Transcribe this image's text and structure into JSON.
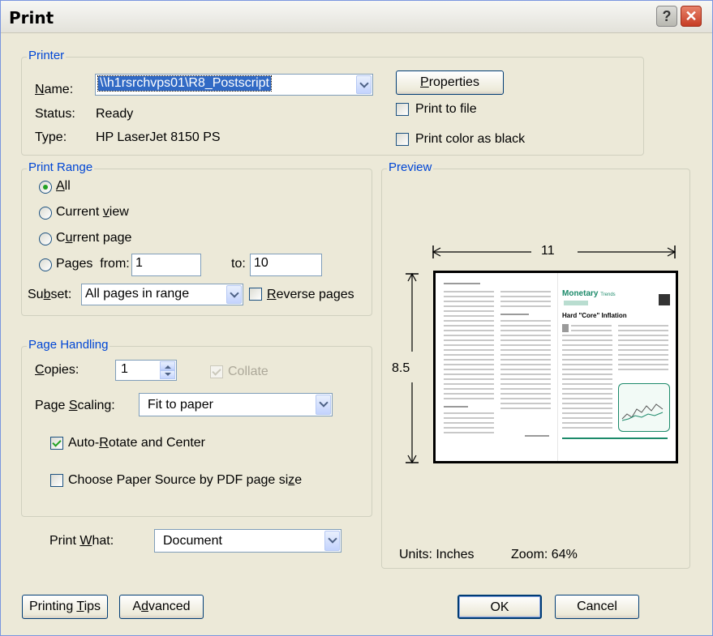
{
  "window": {
    "title": "Print"
  },
  "printer": {
    "legend": "Printer",
    "name_label": "Name:",
    "name_value": "\\\\h1rsrchvps01\\R8_Postscript",
    "status_label": "Status:",
    "status_value": "Ready",
    "type_label": "Type:",
    "type_value": "HP LaserJet 8150 PS",
    "properties_button": "Properties",
    "print_to_file": "Print to file",
    "print_color_black": "Print color as black"
  },
  "print_range": {
    "legend": "Print Range",
    "all": "All",
    "current_view": "Current view",
    "current_page": "Current page",
    "pages": "Pages",
    "from_label": "from:",
    "from_value": "1",
    "to_label": "to:",
    "to_value": "10",
    "subset_label": "Subset:",
    "subset_value": "All pages in range",
    "reverse_pages": "Reverse pages"
  },
  "page_handling": {
    "legend": "Page Handling",
    "copies_label": "Copies:",
    "copies_value": "1",
    "collate": "Collate",
    "scaling_label": "Page Scaling:",
    "scaling_value": "Fit to paper",
    "auto_rotate": "Auto-Rotate and Center",
    "paper_source": "Choose Paper Source by PDF page size"
  },
  "print_what": {
    "label": "Print What:",
    "value": "Document"
  },
  "preview": {
    "legend": "Preview",
    "width_label": "11",
    "height_label": "8.5",
    "units": "Units: Inches",
    "zoom": "Zoom:  64%",
    "doc_brand": "Monetary",
    "doc_brand_suffix": "Trends",
    "doc_heading": "Hard \"Core\" Inflation"
  },
  "buttons": {
    "printing_tips": "Printing Tips",
    "advanced": "Advanced",
    "ok": "OK",
    "cancel": "Cancel"
  },
  "colors": {
    "legend_blue": "#0046d5",
    "face": "#ece9d8",
    "check_green": "#21a121"
  }
}
